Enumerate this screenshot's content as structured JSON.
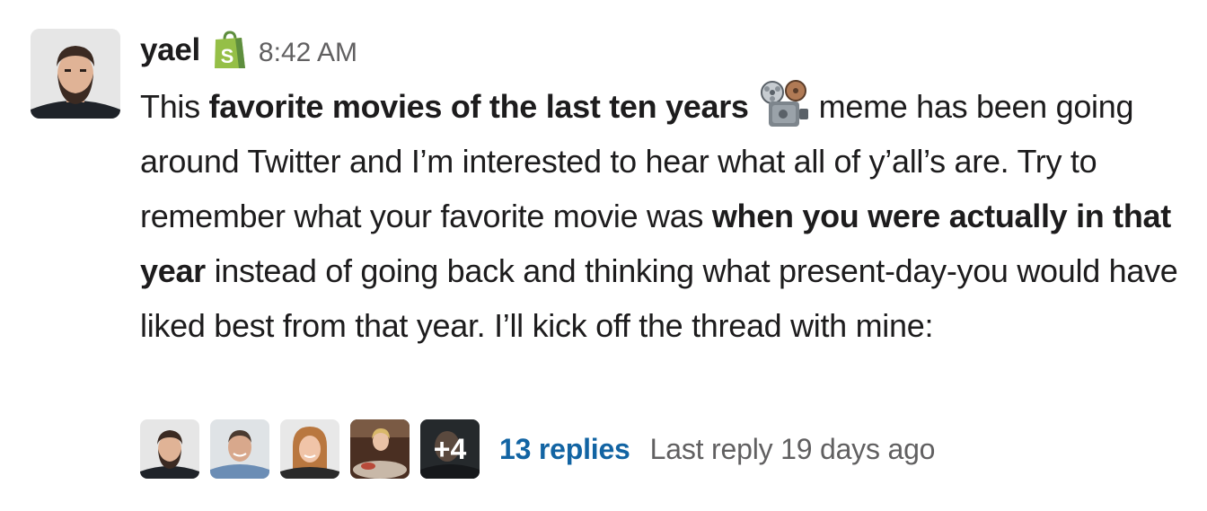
{
  "message": {
    "sender": "yael",
    "badge_icon": "shopify-bag-icon",
    "timestamp": "8:42 AM",
    "body": {
      "part1": "This ",
      "bold1": "favorite movies of the last ten years",
      "emoji_icon": "film-projector-icon",
      "part2": "meme has been going around Twitter and I’m interested to hear what all of y’all’s are. Try to remember what your favorite movie was ",
      "bold2": "when you were actually in that year",
      "part3": "instead of going back and thinking what present-day-you would have liked best from that year. I’ll kick off the thread with mine:"
    }
  },
  "thread": {
    "participant_avatars": [
      "avatar-bearded-man",
      "avatar-man-smiling",
      "avatar-woman-blonde",
      "avatar-woman-dinner",
      "avatar-man-dark"
    ],
    "more_count": "+4",
    "replies_label": "13 replies",
    "last_reply": "Last reply 19 days ago"
  },
  "colors": {
    "link": "#1264a3",
    "muted": "#616061",
    "text": "#1d1c1d",
    "shopify_green": "#95bf47"
  }
}
